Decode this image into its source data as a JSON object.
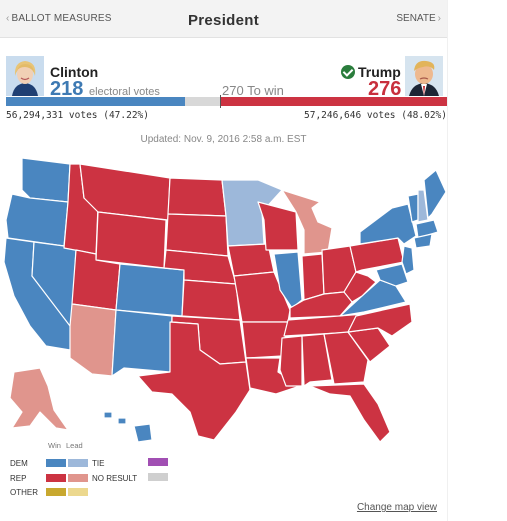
{
  "header": {
    "left_link": "BALLOT MEASURES",
    "title": "President",
    "right_link": "SENATE"
  },
  "candidates": {
    "clinton": {
      "name": "Clinton",
      "electoral_votes": "218",
      "popular": "56,294,331 votes (47.22%)",
      "color": "#4a86c0"
    },
    "trump": {
      "name": "Trump",
      "electoral_votes": "276",
      "popular": "57,246,646 votes (48.02%)",
      "color": "#cc3342",
      "winner": true
    }
  },
  "electoral_label": "electoral votes",
  "to_win": "270 To win",
  "electoral_bar": {
    "dem": 218,
    "undecided": 44,
    "rep": 276,
    "total": 538
  },
  "updated": "Updated: Nov. 9, 2016 2:58 a.m. EST",
  "legend": {
    "win_label": "Win",
    "lead_label": "Lead",
    "rows": [
      {
        "label": "DEM",
        "win": "#4a86c0",
        "lead": "#9db8da"
      },
      {
        "label": "REP",
        "win": "#cc3342",
        "lead": "#e0958d"
      },
      {
        "label": "OTHER",
        "win": "#c8a82f",
        "lead": "#ecd88e"
      }
    ],
    "extra": [
      {
        "label": "TIE",
        "color": "#a14fb3"
      },
      {
        "label": "NO RESULT",
        "color": "#cfcfcf"
      }
    ]
  },
  "change_map": "Change map view",
  "colors": {
    "dem_win": "#4a86c0",
    "dem_lead": "#9db8da",
    "rep_win": "#cc3342",
    "rep_lead": "#e0958d"
  }
}
